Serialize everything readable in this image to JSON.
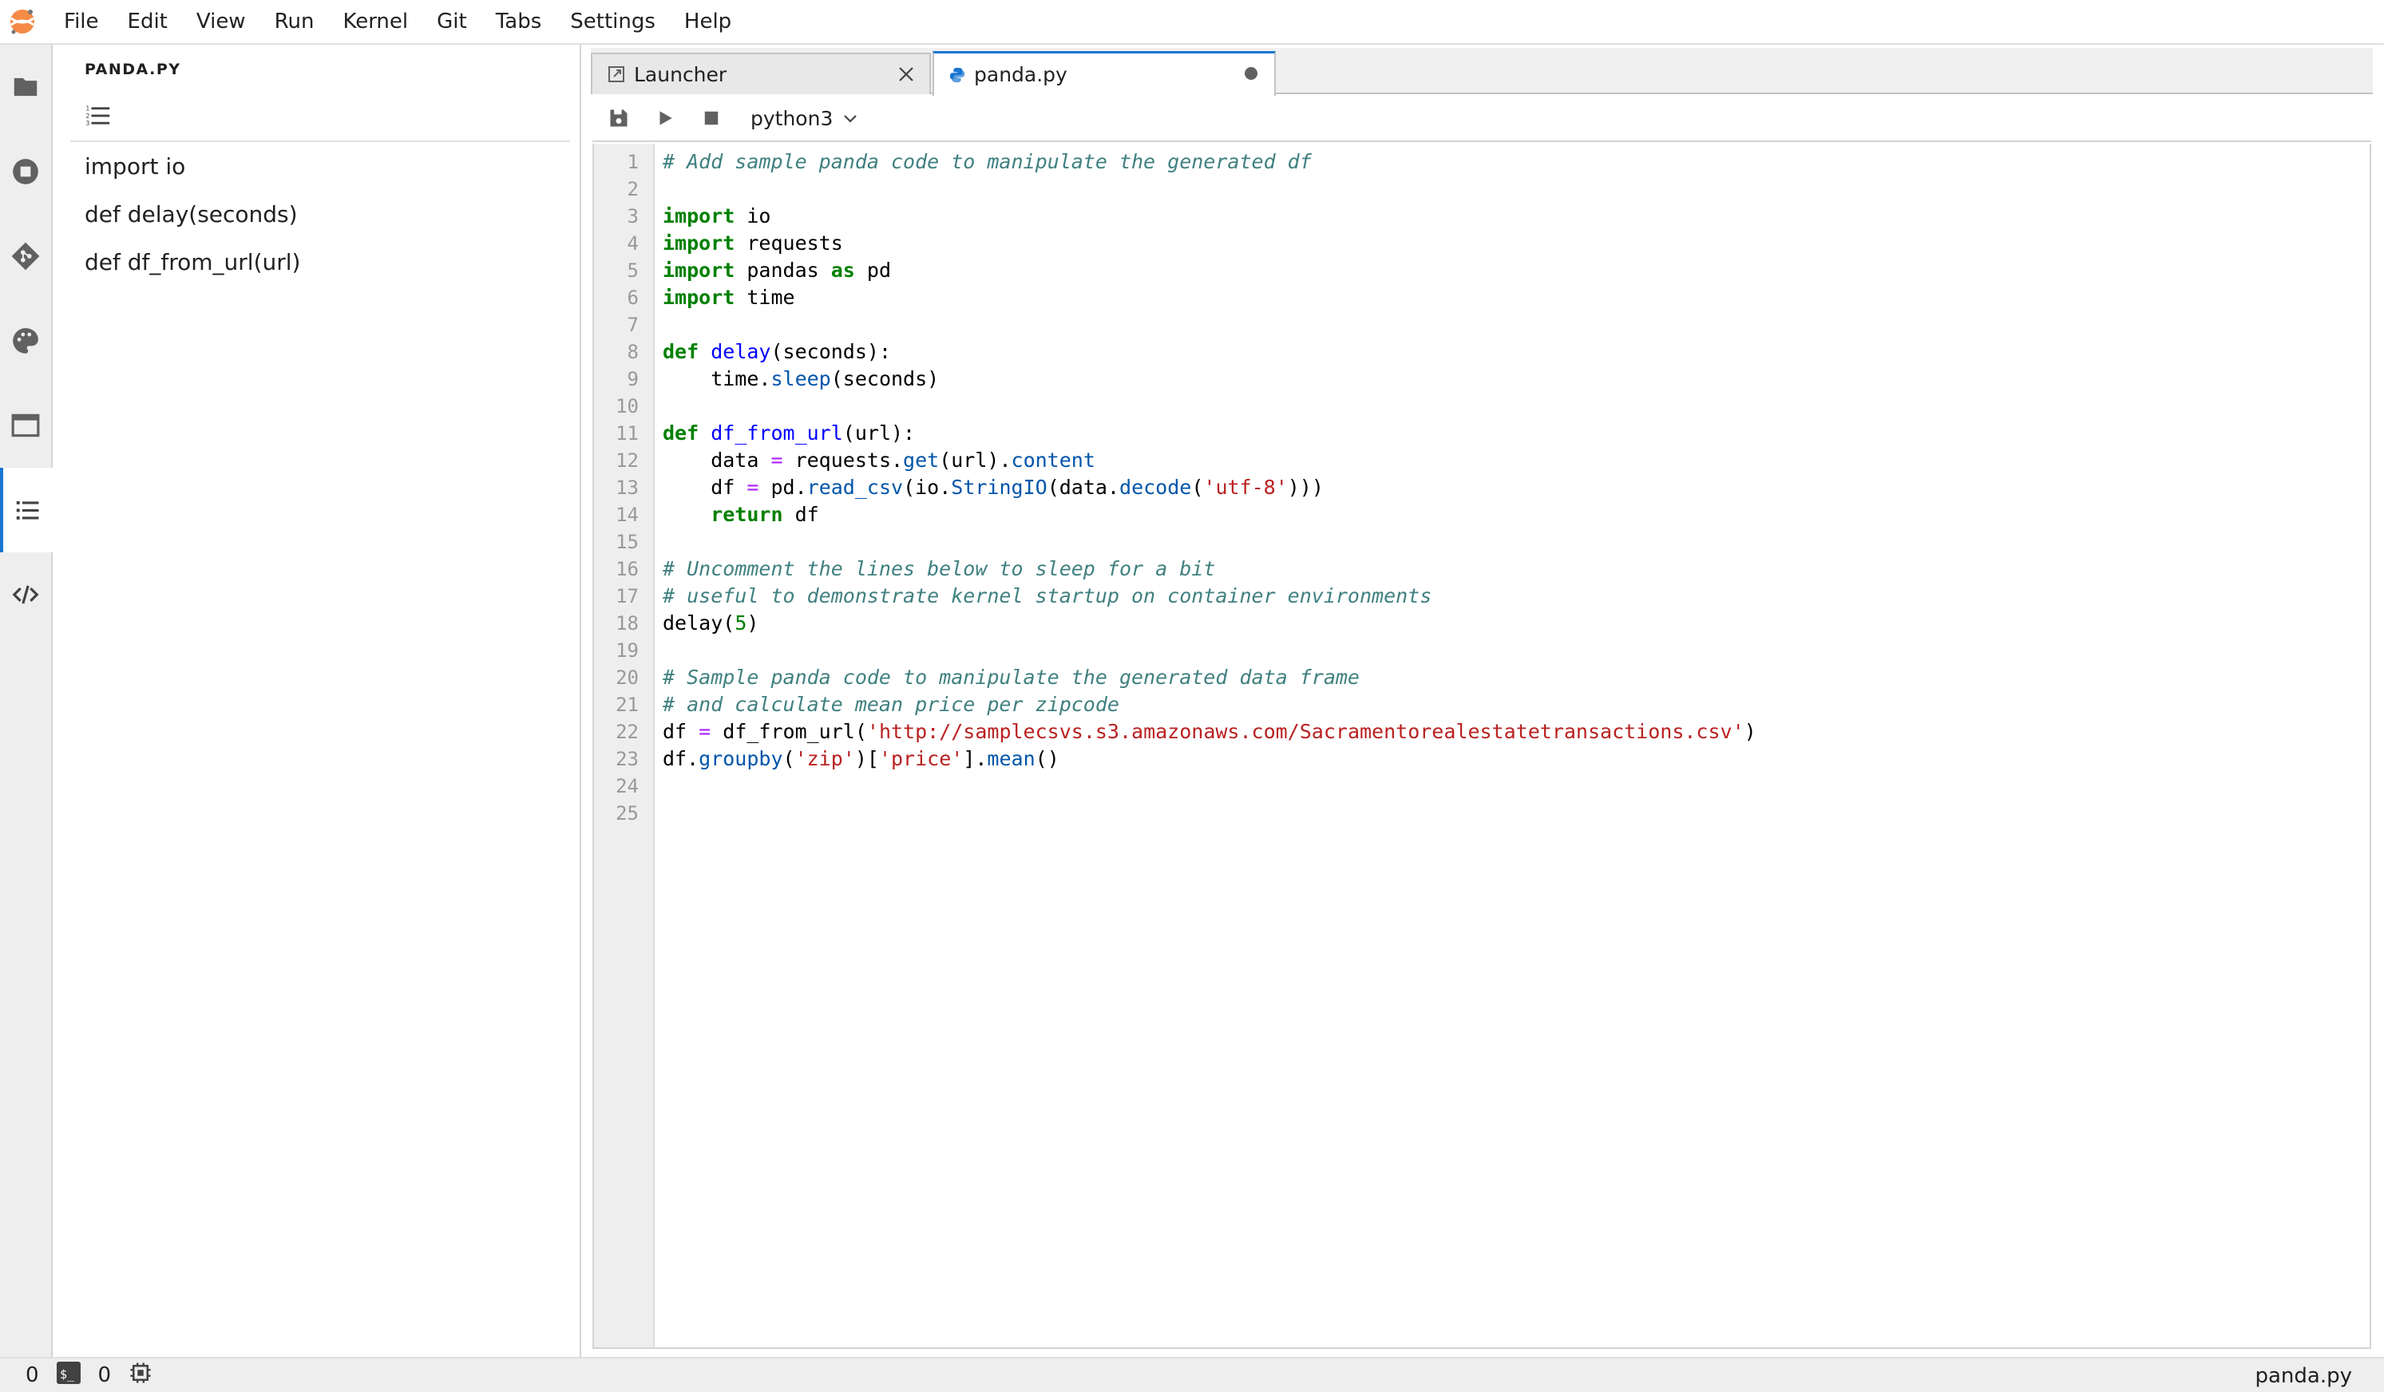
{
  "menubar": {
    "items": [
      "File",
      "Edit",
      "View",
      "Run",
      "Kernel",
      "Git",
      "Tabs",
      "Settings",
      "Help"
    ]
  },
  "activity_bar": {
    "icons": [
      "folder-icon",
      "running-kernels-icon",
      "git-icon",
      "palette-icon",
      "open-tabs-icon",
      "table-of-contents-icon",
      "property-inspector-icon"
    ],
    "active": "table-of-contents-icon"
  },
  "toc": {
    "title": "PANDA.PY",
    "entries": [
      "import io",
      "def delay(seconds)",
      "def df_from_url(url)"
    ]
  },
  "tabs": [
    {
      "label": "Launcher",
      "icon": "launch-icon",
      "active": false
    },
    {
      "label": "panda.py",
      "icon": "python-icon",
      "active": true,
      "unsaved": true
    }
  ],
  "toolbar": {
    "kernel": "python3"
  },
  "editor": {
    "lines": [
      "# Add sample panda code to manipulate the generated df",
      "",
      "import io",
      "import requests",
      "import pandas as pd",
      "import time",
      "",
      "def delay(seconds):",
      "    time.sleep(seconds)",
      "",
      "def df_from_url(url):",
      "    data = requests.get(url).content",
      "    df = pd.read_csv(io.StringIO(data.decode('utf-8')))",
      "    return df",
      "",
      "# Uncomment the lines below to sleep for a bit",
      "# useful to demonstrate kernel startup on container environments",
      "delay(5)",
      "",
      "# Sample panda code to manipulate the generated data frame",
      "# and calculate mean price per zipcode",
      "df = df_from_url('http://samplecsvs.s3.amazonaws.com/Sacramentorealestatetransactions.csv')",
      "df.groupby('zip')['price'].mean()",
      "",
      ""
    ]
  },
  "statusbar": {
    "terminals": "0",
    "kernels": "0",
    "filename": "panda.py"
  }
}
